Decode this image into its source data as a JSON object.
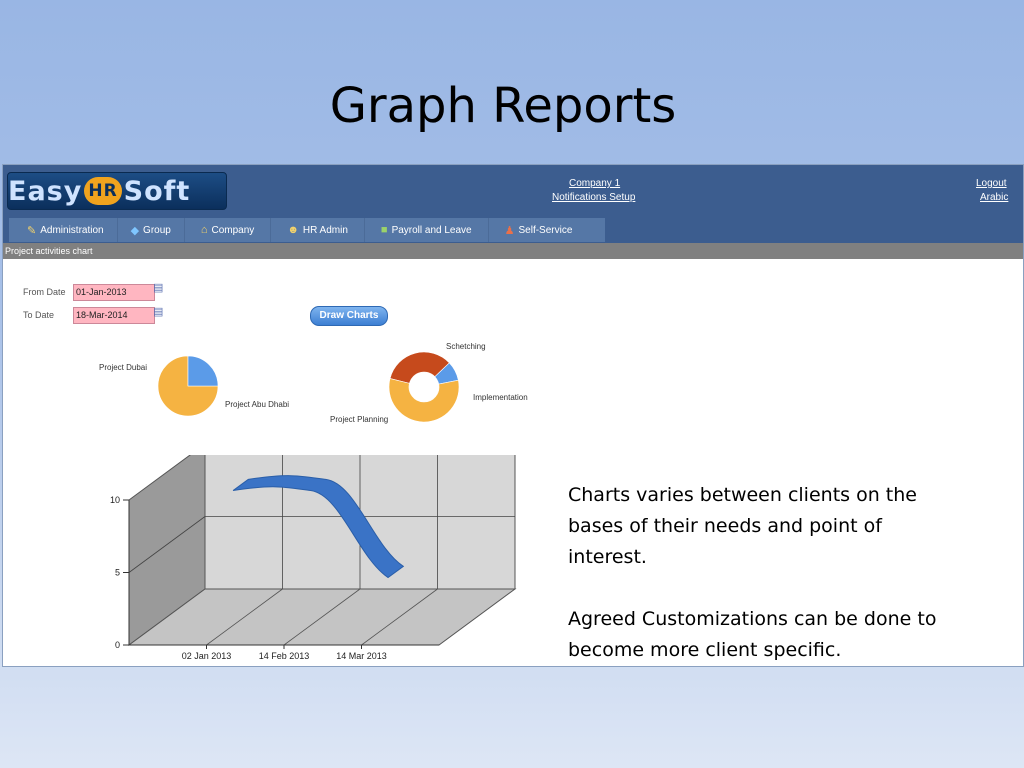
{
  "slide": {
    "title": "Graph Reports",
    "paragraphs": [
      "Charts varies between clients on the bases of their needs and point of interest.",
      "Agreed Customizations can be done to become more client specific."
    ]
  },
  "app": {
    "logo_parts": [
      "Easy",
      "HR",
      "Soft"
    ],
    "header_links": {
      "company": "Company 1",
      "notifications": "Notifications Setup",
      "logout": "Logout",
      "language": "Arabic"
    },
    "nav": [
      {
        "label": "Administration",
        "icon": "wrench-icon"
      },
      {
        "label": "Group",
        "icon": "group-icon"
      },
      {
        "label": "Company",
        "icon": "home-icon"
      },
      {
        "label": "HR Admin",
        "icon": "person-icon"
      },
      {
        "label": "Payroll and Leave",
        "icon": "money-icon"
      },
      {
        "label": "Self-Service",
        "icon": "user-icon"
      }
    ],
    "panel_title": "Project activities chart",
    "form": {
      "from_label": "From Date",
      "from_value": "01-Jan-2013",
      "to_label": "To Date",
      "to_value": "18-Mar-2014",
      "draw_button": "Draw Charts"
    },
    "colors": {
      "header": "#3c5d8f",
      "date_input": "#ffb6c1",
      "series": "#3a73c6"
    }
  },
  "chart_data": [
    {
      "type": "pie",
      "labels": [
        "Project Dubai",
        "Project Abu Dhabi"
      ],
      "values": [
        75,
        25
      ],
      "colors": [
        "#f5b342",
        "#5b9be8"
      ]
    },
    {
      "type": "pie",
      "subtype": "doughnut",
      "labels": [
        "Schetching",
        "Implementation",
        "Project Planning"
      ],
      "values": [
        34,
        9,
        57
      ],
      "colors": [
        "#c64a1c",
        "#5b9be8",
        "#f5b342"
      ]
    },
    {
      "type": "area",
      "subtype": "3d",
      "x": [
        "02 Jan 2013",
        "14 Feb 2013",
        "14 Mar 2013"
      ],
      "yticks": [
        0,
        5,
        10
      ],
      "ylim": [
        0,
        10
      ],
      "series": [
        {
          "values": [
            9.3,
            9.3,
            3.3
          ]
        }
      ]
    }
  ]
}
